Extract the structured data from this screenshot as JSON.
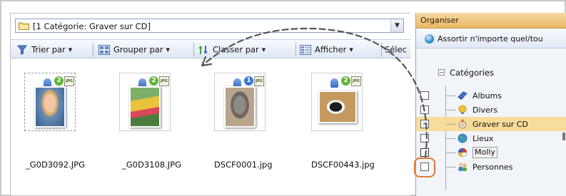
{
  "path_bar": {
    "text": "[1 Catégorie: Graver sur CD]",
    "dropdown_glyph": "▼"
  },
  "toolbar": {
    "items": [
      {
        "icon": "sort-icon",
        "label": "Trier par"
      },
      {
        "icon": "group-icon",
        "label": "Grouper par"
      },
      {
        "icon": "order-icon",
        "label": "Classer par"
      },
      {
        "icon": "view-icon",
        "label": "Afficher"
      },
      {
        "label": "Sélec"
      }
    ],
    "caret": "▼"
  },
  "thumbnails": [
    {
      "name": "_G0D3092.JPG",
      "badge": "2",
      "badge_color": "#63b53a",
      "jpg_label": "JPG",
      "selected_outline": true
    },
    {
      "name": "_G0D3108.JPG",
      "badge": "2",
      "badge_color": "#63b53a",
      "jpg_label": "JPG",
      "selected_outline": false
    },
    {
      "name": "DSCF0001.jpg",
      "badge": "1",
      "badge_color": "#3e77d4",
      "jpg_label": "JPG",
      "selected_outline": false
    },
    {
      "name": "DSCF00443.jpg",
      "badge": "2",
      "badge_color": "#63b53a",
      "jpg_label": "JPG",
      "selected_outline": false
    }
  ],
  "organiser": {
    "title": "Organiser",
    "match_text": "Assortir n'importe quel/tou",
    "categories_title": "Catégories",
    "collapse_glyph": "−",
    "items": [
      {
        "label": "Albums",
        "icon": "albums-icon",
        "checked": ""
      },
      {
        "label": "Divers",
        "icon": "divers-icon",
        "checked": ""
      },
      {
        "label": "Graver sur CD",
        "icon": "burn-cd-icon",
        "checked": "×",
        "selected": true
      },
      {
        "label": "Lieux",
        "icon": "places-icon",
        "checked": ""
      },
      {
        "label": "Molly",
        "icon": "molly-icon",
        "checked": "",
        "highlighted": true
      },
      {
        "label": "Personnes",
        "icon": "people-icon",
        "checked": ""
      }
    ]
  },
  "colors": {
    "header_accent": "#eab866",
    "selected_row": "#f7dc9b",
    "focus_ring": "#e07a33",
    "badge_green": "#63b53a",
    "badge_blue": "#3e77d4"
  }
}
